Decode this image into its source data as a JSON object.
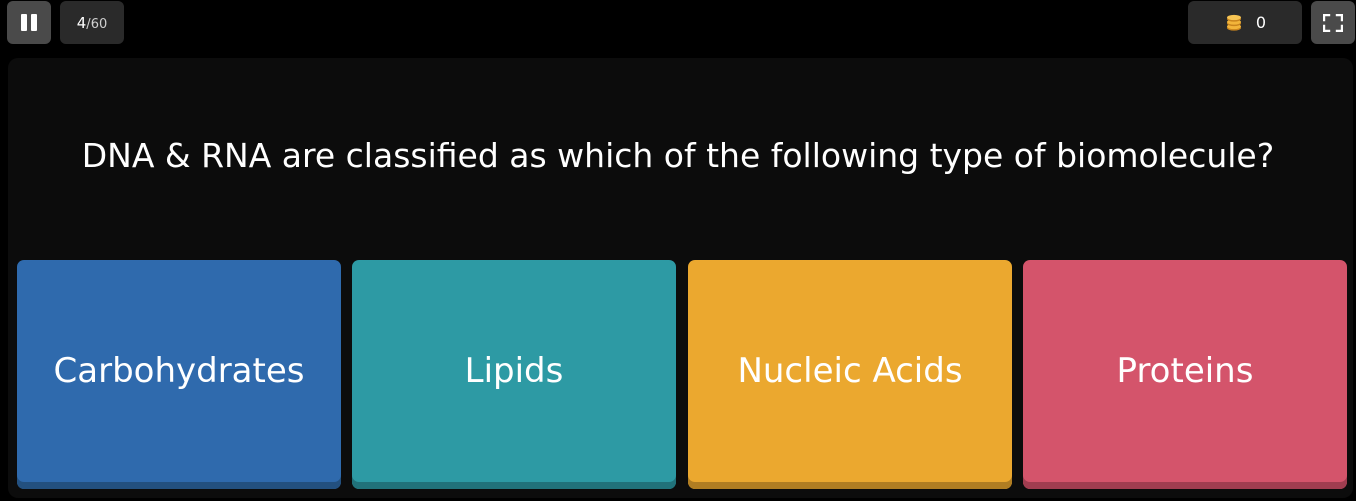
{
  "progress": {
    "current": "4",
    "separator": "/",
    "total": "60"
  },
  "coins": {
    "count": "0",
    "icon": "coin-stack-icon"
  },
  "question": {
    "text": "DNA & RNA are classified as which of the following type of biomolecule?"
  },
  "options": [
    {
      "label": "Carbohydrates",
      "color": "#2f6aad",
      "shadow": "#23507f"
    },
    {
      "label": "Lipids",
      "color": "#2d9aa4",
      "shadow": "#21727a"
    },
    {
      "label": "Nucleic Acids",
      "color": "#eba82f",
      "shadow": "#b07d22"
    },
    {
      "label": "Proteins",
      "color": "#d4546b",
      "shadow": "#a03d50"
    }
  ]
}
